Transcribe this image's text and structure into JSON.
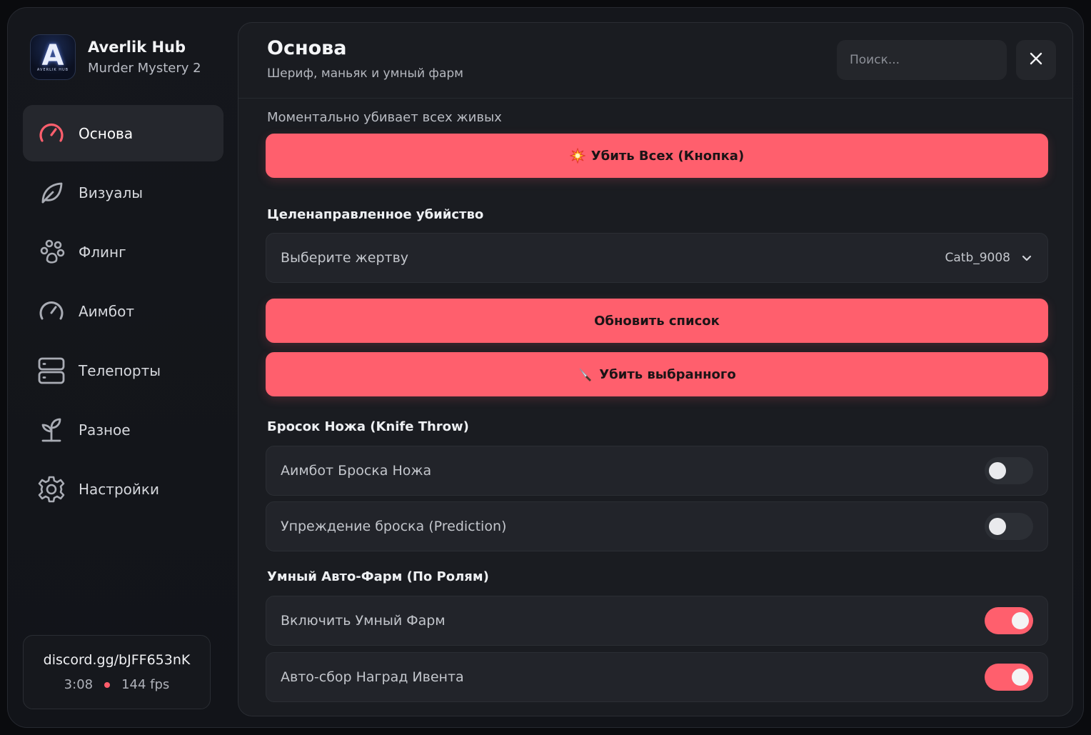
{
  "brand": {
    "name": "Averlik Hub",
    "game": "Murder Mystery 2",
    "logo_letter": "A",
    "logo_subtext": "AVERLIK HUB"
  },
  "sidebar": {
    "items": [
      {
        "label": "Основа",
        "icon": "speedometer-icon",
        "active": true
      },
      {
        "label": "Визуалы",
        "icon": "leaf-icon",
        "active": false
      },
      {
        "label": "Флинг",
        "icon": "paw-icon",
        "active": false
      },
      {
        "label": "Аимбот",
        "icon": "gauge-icon",
        "active": false
      },
      {
        "label": "Телепорты",
        "icon": "server-icon",
        "active": false
      },
      {
        "label": "Разное",
        "icon": "sprout-icon",
        "active": false
      },
      {
        "label": "Настройки",
        "icon": "gear-icon",
        "active": false
      }
    ],
    "footer": {
      "discord": "discord.gg/bJFF653nK",
      "time": "3:08",
      "fps": "144 fps"
    }
  },
  "header": {
    "title": "Основа",
    "subtitle": "Шериф, маньяк и умный фарм",
    "search_placeholder": "Поиск..."
  },
  "content": {
    "kill_all_hint": "Моментально убивает всех живых",
    "kill_all_button": "Убить Всех (Кнопка)",
    "targeted_title": "Целенаправленное убийство",
    "victim_select_label": "Выберите жертву",
    "victim_select_value": "Catb_9008",
    "refresh_button": "Обновить список",
    "kill_selected_button": "Убить выбранного",
    "knife_title": "Бросок Ножа (Knife Throw)",
    "knife_aimbot_label": "Аимбот Броска Ножа",
    "knife_aimbot_on": false,
    "prediction_label": "Упреждение броска (Prediction)",
    "prediction_on": false,
    "farm_title": "Умный Авто-Фарм (По Ролям)",
    "smart_farm_label": "Включить Умный Фарм",
    "smart_farm_on": true,
    "event_rewards_label": "Авто-сбор Наград Ивента",
    "event_rewards_on": true
  },
  "colors": {
    "accent": "#ff5f6d",
    "panel": "#1a1c21",
    "row": "#22242a"
  }
}
